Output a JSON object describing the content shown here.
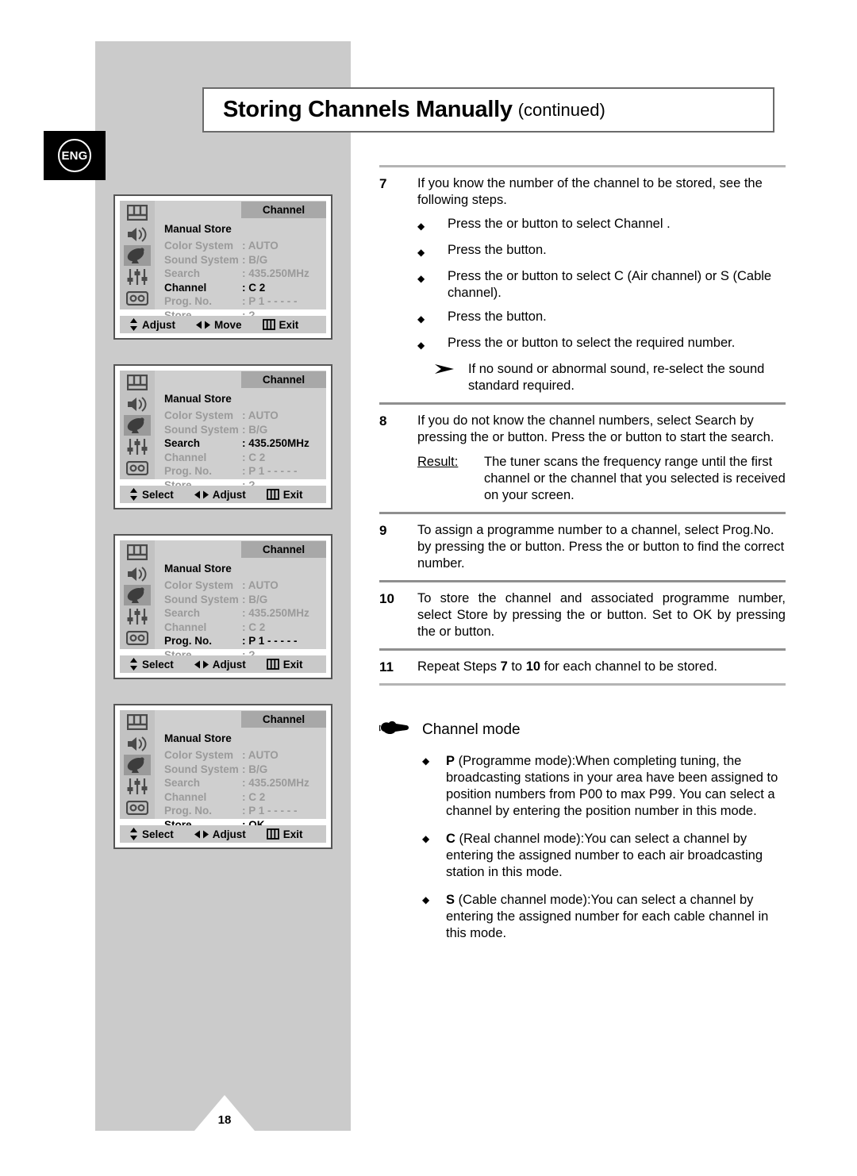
{
  "badge": {
    "label": "ENG"
  },
  "header": {
    "title": "Storing Channels Manually",
    "subtitle": "(continued)"
  },
  "page": {
    "number": "18"
  },
  "osd": {
    "menu_tag": "Channel",
    "section_title": "Manual Store",
    "icons": [
      "picture-icon",
      "sound-icon",
      "channel-dish-icon",
      "setup-sliders-icon",
      "vcr-icon"
    ],
    "rows": [
      {
        "label": "Color System",
        "value": ": AUTO"
      },
      {
        "label": "Sound System",
        "value": ": B/G"
      },
      {
        "label": "Search",
        "value": ": 435.250MHz"
      },
      {
        "label": "Channel",
        "value": ": C  2"
      },
      {
        "label": "Prog. No.",
        "value": ": P  1 - - - - -"
      },
      {
        "label": "Store",
        "value": ":  ?"
      }
    ],
    "screens": [
      {
        "highlight": "Channel",
        "store_value": ":  ?",
        "bar": [
          "Adjust",
          "Move",
          "Exit"
        ]
      },
      {
        "highlight": "Search",
        "store_value": ":  ?",
        "bar": [
          "Select",
          "Adjust",
          "Exit"
        ]
      },
      {
        "highlight": "Prog. No.",
        "store_value": ":  ?",
        "bar": [
          "Select",
          "Adjust",
          "Exit"
        ]
      },
      {
        "highlight": "Store",
        "store_value": ": OK",
        "bar": [
          "Select",
          "Adjust",
          "Exit"
        ]
      }
    ]
  },
  "steps": {
    "s7": {
      "num": "7",
      "text": "If you know the number of the channel to be stored, see the following steps.",
      "bullets": [
        "Press the      or      button to select Channel  .",
        "Press the      button.",
        "Press the      or      button to select C (Air channel) or S (Cable channel).",
        "Press the      button.",
        "Press the      or      button to select the required number."
      ],
      "note": "If no sound or abnormal sound, re-select the sound standard required."
    },
    "s8": {
      "num": "8",
      "text": "If you do not know the channel numbers, select Search  by pressing the      or      button. Press the      or      button to start the search.",
      "result_label": "Result:",
      "result_text": "The tuner scans the frequency range until the first channel or the channel that you selected is received on your screen."
    },
    "s9": {
      "num": "9",
      "text": "To assign a programme number to a channel, select Prog.No.    by pressing the      or      button. Press the      or      button to find the correct number."
    },
    "s10": {
      "num": "10",
      "text": "To store the channel and associated programme number, select Store  by pressing the      or      button. Set to OK by pressing the      or      button."
    },
    "s11": {
      "num": "11",
      "text_pre": "Repeat Steps ",
      "a": "7",
      "text_mid": " to ",
      "b": "10",
      "text_post": " for each channel to be stored."
    }
  },
  "channel_mode": {
    "title": "Channel mode",
    "items": [
      {
        "key": "P",
        "text": " (Programme mode):When completing tuning, the broadcasting stations in your area have been assigned to position numbers from P00 to max P99. You can select a channel by entering the position number in this mode."
      },
      {
        "key": "C",
        "text": " (Real channel mode):You can select a channel by entering the assigned number to each air broadcasting station in this mode."
      },
      {
        "key": "S",
        "text": " (Cable channel mode):You can select a channel by entering the assigned number for each cable channel in this mode."
      }
    ]
  }
}
